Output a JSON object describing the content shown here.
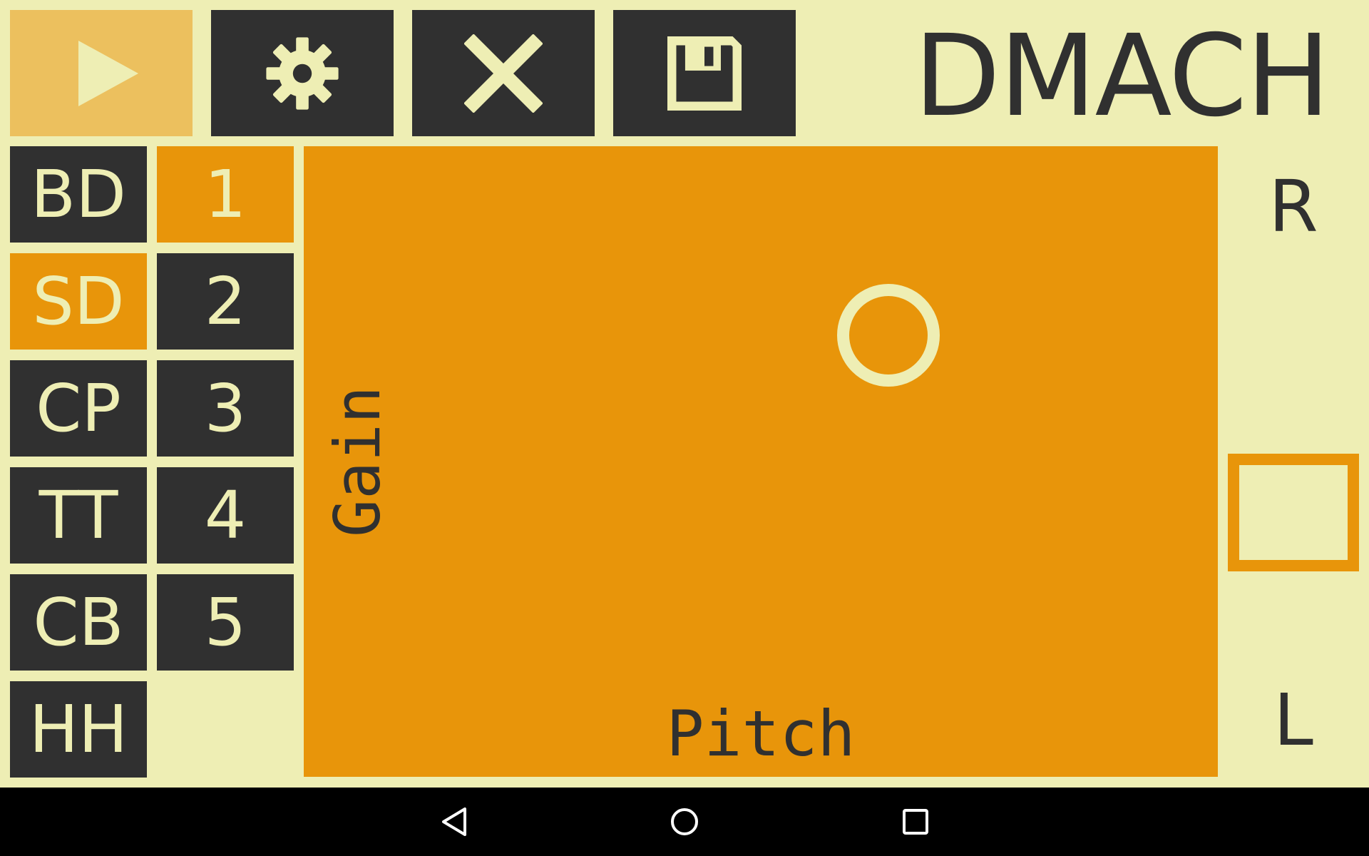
{
  "app": {
    "title": "DMACH"
  },
  "toolbar": {
    "buttons": [
      {
        "name": "play",
        "icon": "play-icon",
        "active": true
      },
      {
        "name": "settings",
        "icon": "gear-icon",
        "active": false
      },
      {
        "name": "clear",
        "icon": "close-icon",
        "active": false
      },
      {
        "name": "save",
        "icon": "floppy-disk-icon",
        "active": false
      }
    ]
  },
  "instruments": {
    "items": [
      "BD",
      "SD",
      "CP",
      "TT",
      "CB",
      "HH"
    ],
    "selected": "SD"
  },
  "patterns": {
    "items": [
      "1",
      "2",
      "3",
      "4",
      "5"
    ],
    "selected": "1"
  },
  "xy_pad": {
    "x_label": "Pitch",
    "y_label": "Gain",
    "cursor": {
      "pitch": 0.64,
      "gain": 0.7
    }
  },
  "pan": {
    "top_label": "R",
    "bottom_label": "L",
    "value": 0.4
  },
  "navbar": {
    "buttons": [
      "back-icon",
      "home-icon",
      "recents-icon"
    ]
  },
  "colors": {
    "background": "#eeeeb4",
    "dark": "#303030",
    "accent": "#e8950a",
    "play_active": "#ecc05e",
    "navbar": "#000000"
  }
}
